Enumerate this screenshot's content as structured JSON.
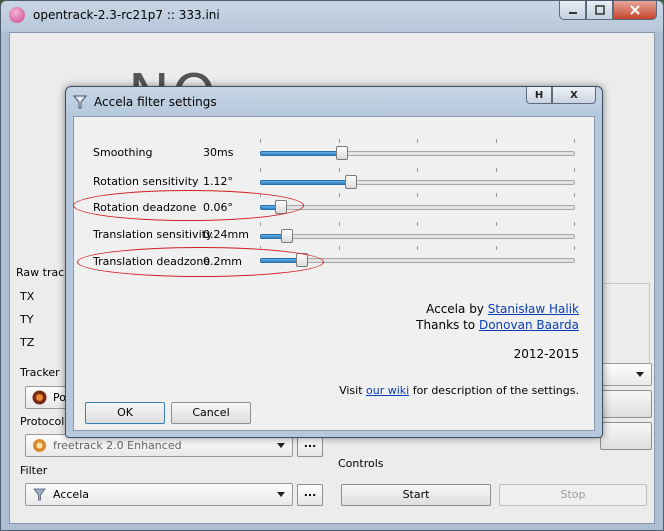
{
  "main": {
    "title": "opentrack-2.3-rc21p7 :: 333.ini",
    "no_video": "NO",
    "raw_tracker_label": "Raw track",
    "axes": [
      "TX",
      "TY",
      "TZ"
    ],
    "tracker_label": "Tracker",
    "tracker_value": "Poi",
    "protocol_label": "Protocol",
    "protocol_value": "freetrack 2.0 Enhanced",
    "filter_label": "Filter",
    "filter_value": "Accela",
    "dots": "...",
    "controls_label": "Controls",
    "start_label": "Start",
    "stop_label": "Stop"
  },
  "dialog": {
    "title": "Accela filter settings",
    "help_label": "H",
    "close_label": "X",
    "rows": [
      {
        "label": "Smoothing",
        "value": "30ms",
        "level": 0.25
      },
      {
        "label": "Rotation sensitivity",
        "value": "1.12°",
        "level": 0.28
      },
      {
        "label": "Rotation deadzone",
        "value": "0.06°",
        "level": 0.05
      },
      {
        "label": "Translation sensitivity",
        "value": "0.24mm",
        "level": 0.07
      },
      {
        "label": "Translation deadzone",
        "value": "0.2mm",
        "level": 0.12
      }
    ],
    "credits": {
      "line1_prefix": "Accela by ",
      "line1_link": "Stanisław Halik",
      "line2_prefix": "Thanks to ",
      "line2_link": "Donovan Baarda",
      "years": "2012-2015",
      "visit_prefix": "Visit ",
      "visit_link": "our wiki",
      "visit_suffix": " for description of the settings."
    },
    "ok_label": "OK",
    "cancel_label": "Cancel"
  },
  "colors": {
    "annotation": "#d31c1c",
    "slider_fill": "#2f7fc3",
    "link": "#0a3fb3"
  }
}
